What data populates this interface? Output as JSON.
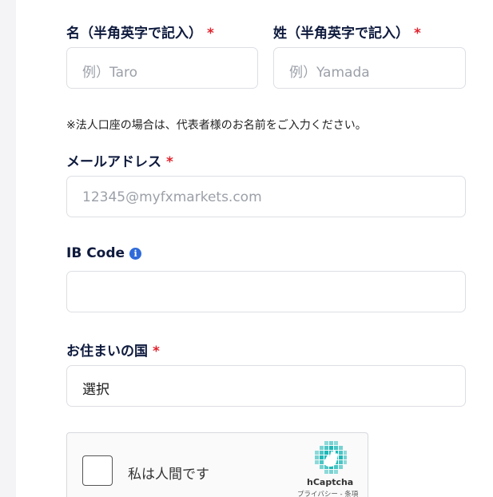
{
  "first_name": {
    "label": "名（半角英字で記入）",
    "required": "*",
    "placeholder": "例）Taro"
  },
  "last_name": {
    "label": "姓（半角英字で記入）",
    "required": "*",
    "placeholder": "例）Yamada"
  },
  "corporate_note": "※法人口座の場合は、代表者様のお名前をご入力ください。",
  "email": {
    "label": "メールアドレス",
    "required": "*",
    "placeholder": "12345@myfxmarkets.com"
  },
  "ib_code": {
    "label": "IB Code",
    "info_icon": "i",
    "value": ""
  },
  "country": {
    "label": "お住まいの国",
    "required": "*",
    "value": "選択"
  },
  "captcha": {
    "checkbox_label": "私は人間です",
    "brand": "hCaptcha",
    "links": "プライバシー - 条項"
  },
  "colors": {
    "heading": "#0e1a3d",
    "required": "#e0222d",
    "info": "#2f6bd9",
    "placeholder": "#9ba0a8",
    "captcha_logo": "#1fb8b8"
  }
}
